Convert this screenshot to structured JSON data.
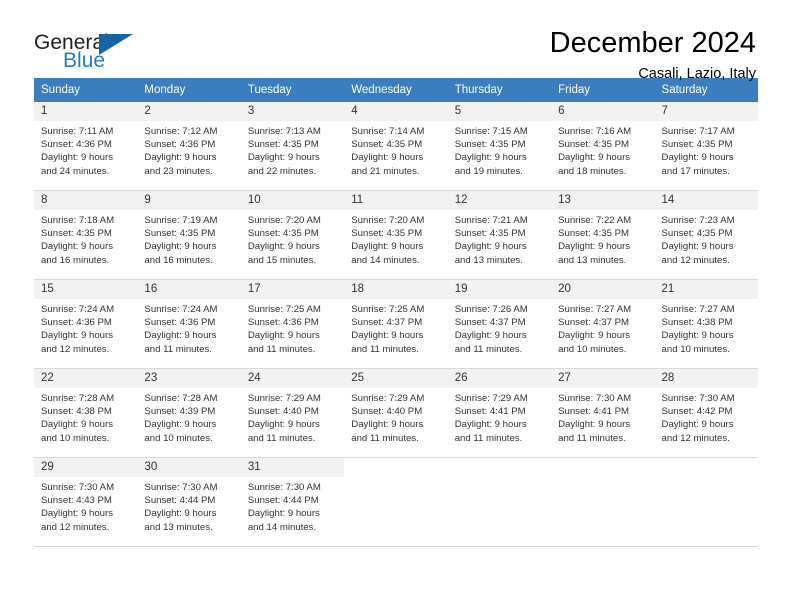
{
  "brand": {
    "name_top": "General",
    "name_bottom": "Blue",
    "triangle_color": "#1266a8",
    "blue_text_color": "#1f7fc4"
  },
  "header": {
    "title": "December 2024",
    "subtitle": "Casali, Lazio, Italy"
  },
  "theme": {
    "header_row_bg": "#3a7ebf",
    "daynum_bg": "#f2f2f2",
    "grid_line": "#d9d9d9",
    "text": "#333333"
  },
  "weekday_headers": [
    "Sunday",
    "Monday",
    "Tuesday",
    "Wednesday",
    "Thursday",
    "Friday",
    "Saturday"
  ],
  "weeks": [
    [
      {
        "day": "1",
        "sunrise": "Sunrise: 7:11 AM",
        "sunset": "Sunset: 4:36 PM",
        "daylight1": "Daylight: 9 hours",
        "daylight2": "and 24 minutes."
      },
      {
        "day": "2",
        "sunrise": "Sunrise: 7:12 AM",
        "sunset": "Sunset: 4:36 PM",
        "daylight1": "Daylight: 9 hours",
        "daylight2": "and 23 minutes."
      },
      {
        "day": "3",
        "sunrise": "Sunrise: 7:13 AM",
        "sunset": "Sunset: 4:35 PM",
        "daylight1": "Daylight: 9 hours",
        "daylight2": "and 22 minutes."
      },
      {
        "day": "4",
        "sunrise": "Sunrise: 7:14 AM",
        "sunset": "Sunset: 4:35 PM",
        "daylight1": "Daylight: 9 hours",
        "daylight2": "and 21 minutes."
      },
      {
        "day": "5",
        "sunrise": "Sunrise: 7:15 AM",
        "sunset": "Sunset: 4:35 PM",
        "daylight1": "Daylight: 9 hours",
        "daylight2": "and 19 minutes."
      },
      {
        "day": "6",
        "sunrise": "Sunrise: 7:16 AM",
        "sunset": "Sunset: 4:35 PM",
        "daylight1": "Daylight: 9 hours",
        "daylight2": "and 18 minutes."
      },
      {
        "day": "7",
        "sunrise": "Sunrise: 7:17 AM",
        "sunset": "Sunset: 4:35 PM",
        "daylight1": "Daylight: 9 hours",
        "daylight2": "and 17 minutes."
      }
    ],
    [
      {
        "day": "8",
        "sunrise": "Sunrise: 7:18 AM",
        "sunset": "Sunset: 4:35 PM",
        "daylight1": "Daylight: 9 hours",
        "daylight2": "and 16 minutes."
      },
      {
        "day": "9",
        "sunrise": "Sunrise: 7:19 AM",
        "sunset": "Sunset: 4:35 PM",
        "daylight1": "Daylight: 9 hours",
        "daylight2": "and 16 minutes."
      },
      {
        "day": "10",
        "sunrise": "Sunrise: 7:20 AM",
        "sunset": "Sunset: 4:35 PM",
        "daylight1": "Daylight: 9 hours",
        "daylight2": "and 15 minutes."
      },
      {
        "day": "11",
        "sunrise": "Sunrise: 7:20 AM",
        "sunset": "Sunset: 4:35 PM",
        "daylight1": "Daylight: 9 hours",
        "daylight2": "and 14 minutes."
      },
      {
        "day": "12",
        "sunrise": "Sunrise: 7:21 AM",
        "sunset": "Sunset: 4:35 PM",
        "daylight1": "Daylight: 9 hours",
        "daylight2": "and 13 minutes."
      },
      {
        "day": "13",
        "sunrise": "Sunrise: 7:22 AM",
        "sunset": "Sunset: 4:35 PM",
        "daylight1": "Daylight: 9 hours",
        "daylight2": "and 13 minutes."
      },
      {
        "day": "14",
        "sunrise": "Sunrise: 7:23 AM",
        "sunset": "Sunset: 4:35 PM",
        "daylight1": "Daylight: 9 hours",
        "daylight2": "and 12 minutes."
      }
    ],
    [
      {
        "day": "15",
        "sunrise": "Sunrise: 7:24 AM",
        "sunset": "Sunset: 4:36 PM",
        "daylight1": "Daylight: 9 hours",
        "daylight2": "and 12 minutes."
      },
      {
        "day": "16",
        "sunrise": "Sunrise: 7:24 AM",
        "sunset": "Sunset: 4:36 PM",
        "daylight1": "Daylight: 9 hours",
        "daylight2": "and 11 minutes."
      },
      {
        "day": "17",
        "sunrise": "Sunrise: 7:25 AM",
        "sunset": "Sunset: 4:36 PM",
        "daylight1": "Daylight: 9 hours",
        "daylight2": "and 11 minutes."
      },
      {
        "day": "18",
        "sunrise": "Sunrise: 7:25 AM",
        "sunset": "Sunset: 4:37 PM",
        "daylight1": "Daylight: 9 hours",
        "daylight2": "and 11 minutes."
      },
      {
        "day": "19",
        "sunrise": "Sunrise: 7:26 AM",
        "sunset": "Sunset: 4:37 PM",
        "daylight1": "Daylight: 9 hours",
        "daylight2": "and 11 minutes."
      },
      {
        "day": "20",
        "sunrise": "Sunrise: 7:27 AM",
        "sunset": "Sunset: 4:37 PM",
        "daylight1": "Daylight: 9 hours",
        "daylight2": "and 10 minutes."
      },
      {
        "day": "21",
        "sunrise": "Sunrise: 7:27 AM",
        "sunset": "Sunset: 4:38 PM",
        "daylight1": "Daylight: 9 hours",
        "daylight2": "and 10 minutes."
      }
    ],
    [
      {
        "day": "22",
        "sunrise": "Sunrise: 7:28 AM",
        "sunset": "Sunset: 4:38 PM",
        "daylight1": "Daylight: 9 hours",
        "daylight2": "and 10 minutes."
      },
      {
        "day": "23",
        "sunrise": "Sunrise: 7:28 AM",
        "sunset": "Sunset: 4:39 PM",
        "daylight1": "Daylight: 9 hours",
        "daylight2": "and 10 minutes."
      },
      {
        "day": "24",
        "sunrise": "Sunrise: 7:29 AM",
        "sunset": "Sunset: 4:40 PM",
        "daylight1": "Daylight: 9 hours",
        "daylight2": "and 11 minutes."
      },
      {
        "day": "25",
        "sunrise": "Sunrise: 7:29 AM",
        "sunset": "Sunset: 4:40 PM",
        "daylight1": "Daylight: 9 hours",
        "daylight2": "and 11 minutes."
      },
      {
        "day": "26",
        "sunrise": "Sunrise: 7:29 AM",
        "sunset": "Sunset: 4:41 PM",
        "daylight1": "Daylight: 9 hours",
        "daylight2": "and 11 minutes."
      },
      {
        "day": "27",
        "sunrise": "Sunrise: 7:30 AM",
        "sunset": "Sunset: 4:41 PM",
        "daylight1": "Daylight: 9 hours",
        "daylight2": "and 11 minutes."
      },
      {
        "day": "28",
        "sunrise": "Sunrise: 7:30 AM",
        "sunset": "Sunset: 4:42 PM",
        "daylight1": "Daylight: 9 hours",
        "daylight2": "and 12 minutes."
      }
    ],
    [
      {
        "day": "29",
        "sunrise": "Sunrise: 7:30 AM",
        "sunset": "Sunset: 4:43 PM",
        "daylight1": "Daylight: 9 hours",
        "daylight2": "and 12 minutes."
      },
      {
        "day": "30",
        "sunrise": "Sunrise: 7:30 AM",
        "sunset": "Sunset: 4:44 PM",
        "daylight1": "Daylight: 9 hours",
        "daylight2": "and 13 minutes."
      },
      {
        "day": "31",
        "sunrise": "Sunrise: 7:30 AM",
        "sunset": "Sunset: 4:44 PM",
        "daylight1": "Daylight: 9 hours",
        "daylight2": "and 14 minutes."
      },
      {
        "day": "",
        "sunrise": "",
        "sunset": "",
        "daylight1": "",
        "daylight2": ""
      },
      {
        "day": "",
        "sunrise": "",
        "sunset": "",
        "daylight1": "",
        "daylight2": ""
      },
      {
        "day": "",
        "sunrise": "",
        "sunset": "",
        "daylight1": "",
        "daylight2": ""
      },
      {
        "day": "",
        "sunrise": "",
        "sunset": "",
        "daylight1": "",
        "daylight2": ""
      }
    ]
  ]
}
